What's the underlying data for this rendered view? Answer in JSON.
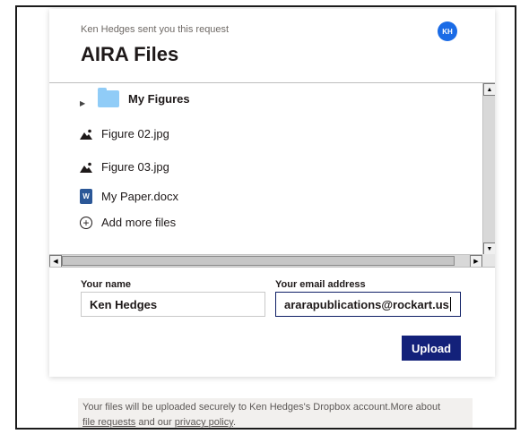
{
  "request": {
    "sender_text": "Ken Hedges sent you this request",
    "avatar_initials": "KH",
    "title": "AIRA Files"
  },
  "files": {
    "items": [
      {
        "name": "My Figures",
        "icon": "folder-icon"
      },
      {
        "name": "Figure 02.jpg",
        "icon": "image-icon"
      },
      {
        "name": "Figure 03.jpg",
        "icon": "image-icon"
      },
      {
        "name": "My Paper.docx",
        "icon": "word-doc-icon"
      }
    ],
    "add_more_label": "Add more files"
  },
  "form": {
    "name_label": "Your name",
    "name_value": "Ken Hedges",
    "email_label": "Your email address",
    "email_value": "ararapublications@rockart.us",
    "upload_label": "Upload"
  },
  "footer": {
    "text1": "Your files will be uploaded securely to Ken Hedges's Dropbox account.More about",
    "link1": "file requests",
    "text2": " and our ",
    "link2": "privacy policy",
    "text3": "."
  },
  "colors": {
    "accent": "#13217a",
    "avatar": "#1a6be6",
    "folder": "#90ccf7"
  }
}
